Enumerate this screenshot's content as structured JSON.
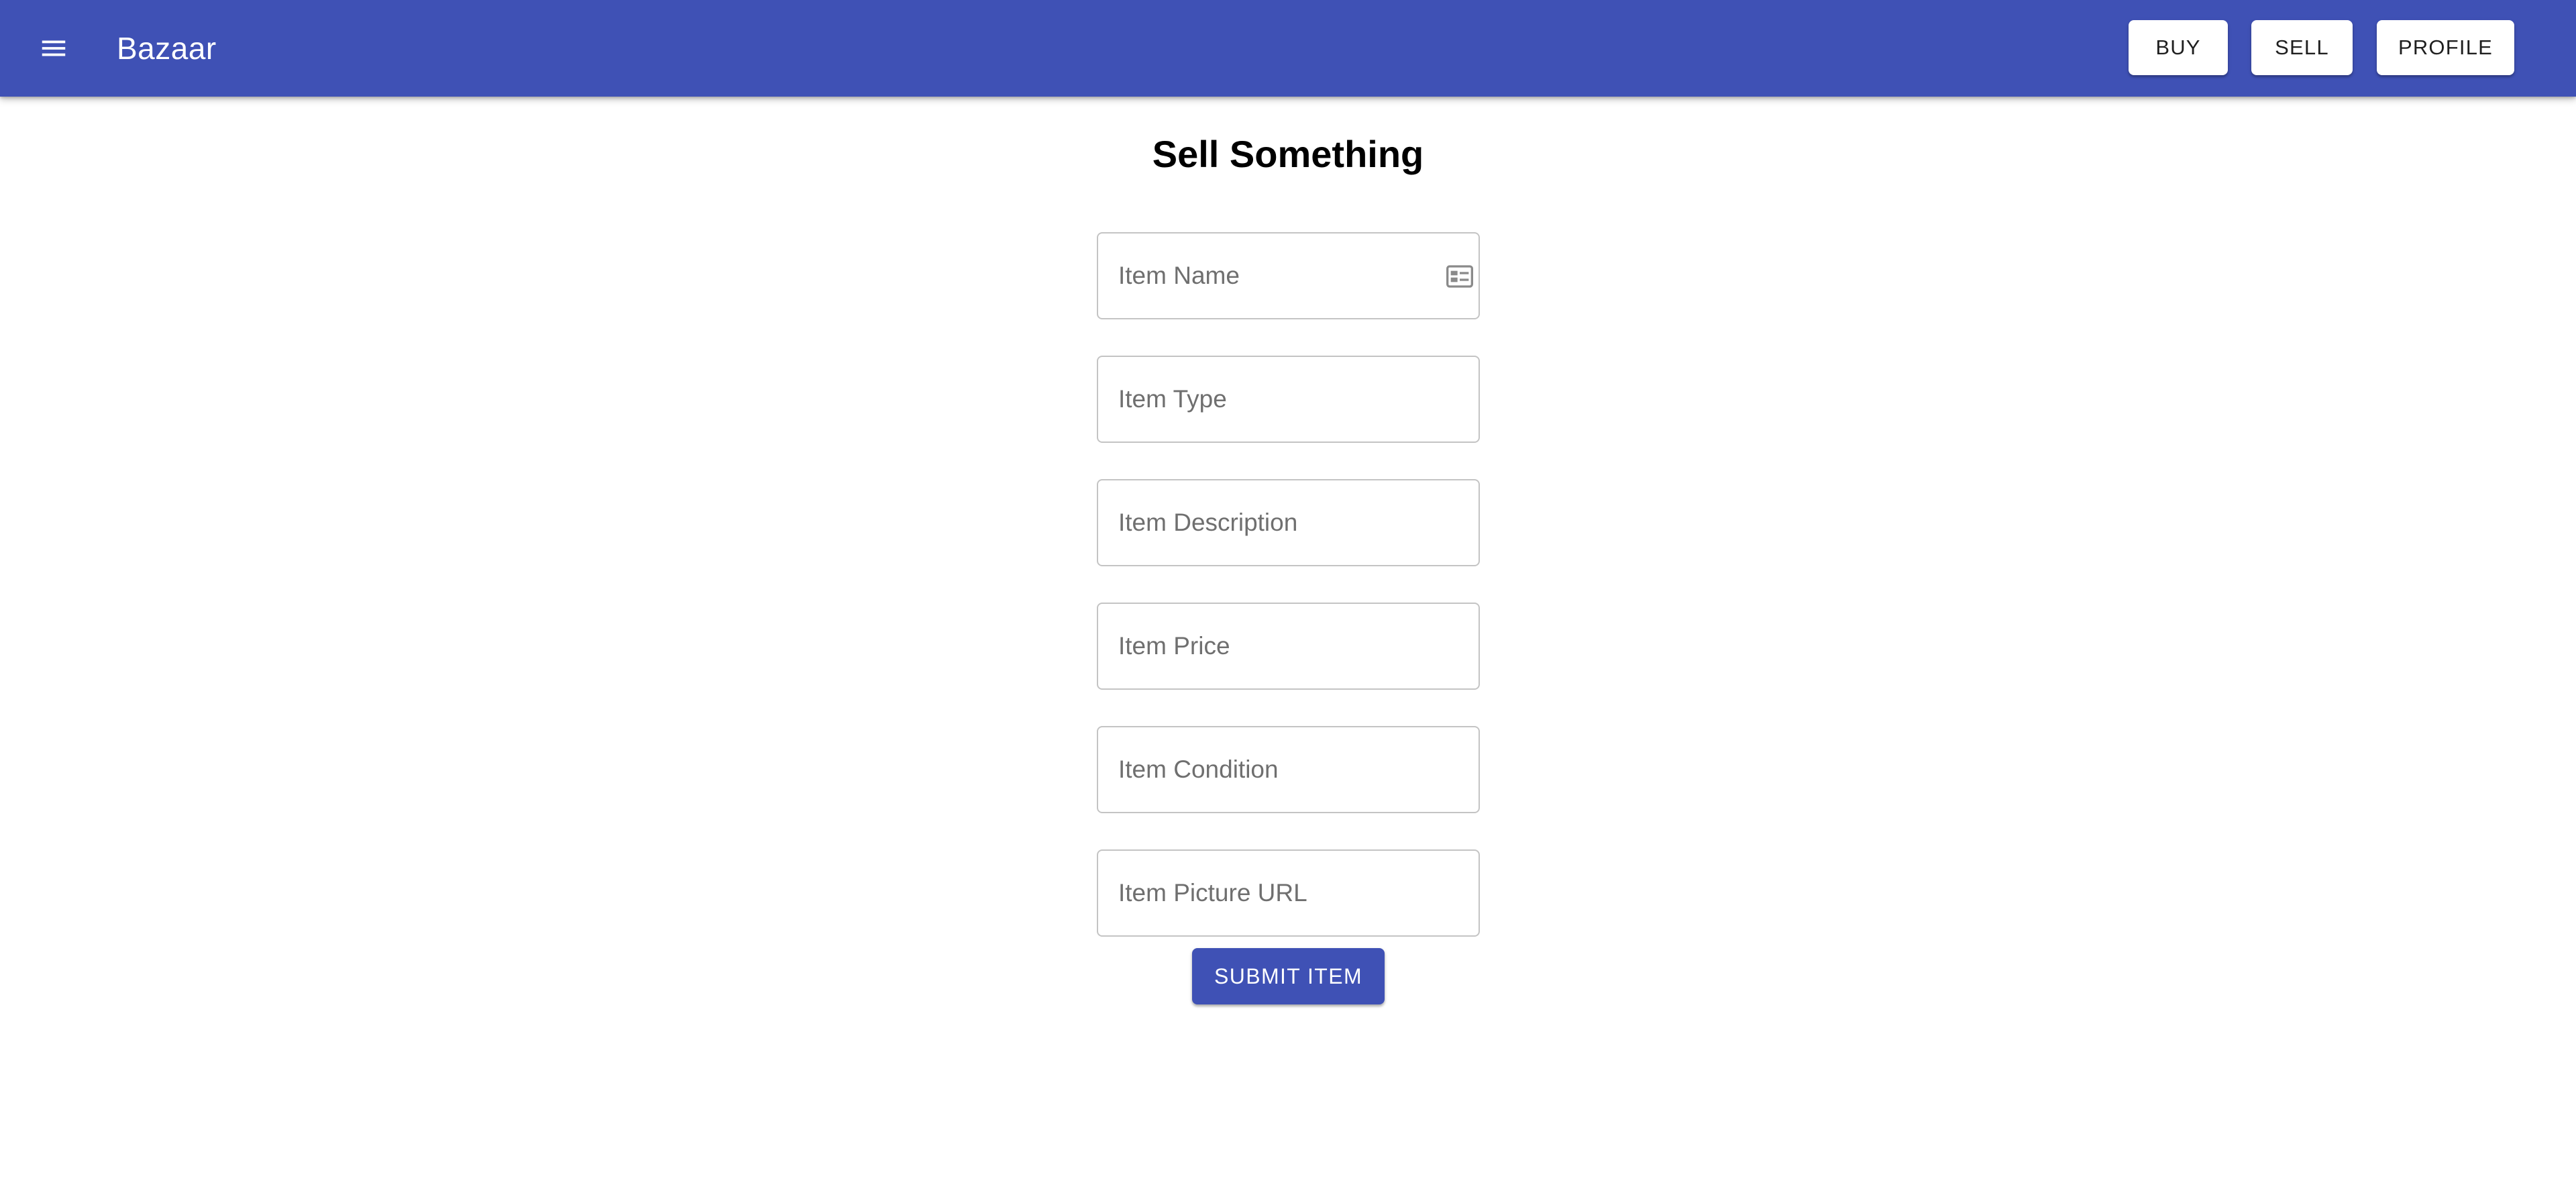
{
  "app": {
    "title": "Bazaar",
    "menu_icon": "hamburger-menu-icon"
  },
  "nav": {
    "buy_label": "BUY",
    "sell_label": "SELL",
    "profile_label": "PROFILE"
  },
  "page": {
    "heading": "Sell Something"
  },
  "form": {
    "fields": [
      {
        "placeholder": "Item Name",
        "value": "",
        "icon": "id-card-icon"
      },
      {
        "placeholder": "Item Type",
        "value": ""
      },
      {
        "placeholder": "Item Description",
        "value": ""
      },
      {
        "placeholder": "Item Price",
        "value": ""
      },
      {
        "placeholder": "Item Condition",
        "value": ""
      },
      {
        "placeholder": "Item Picture URL",
        "value": ""
      }
    ],
    "submit_label": "SUBMIT ITEM"
  },
  "colors": {
    "primary": "#3f51b5",
    "appbar_text": "#ffffff",
    "field_border": "#c4c4c4",
    "placeholder": "#6f6f6f"
  }
}
